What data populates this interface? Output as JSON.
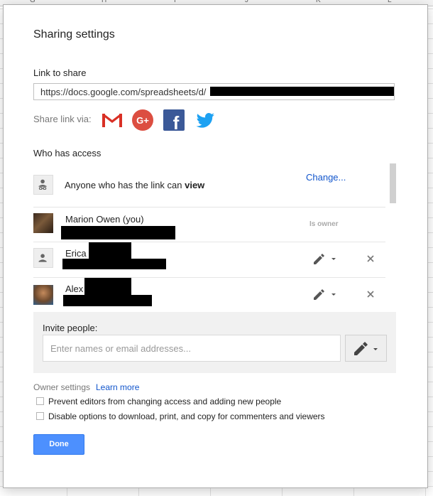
{
  "spreadsheet": {
    "columns": [
      "G",
      "H",
      "I",
      "J",
      "K",
      "L"
    ]
  },
  "dialog": {
    "title": "Sharing settings",
    "link_section": {
      "label": "Link to share",
      "url": "https://docs.google.com/spreadsheets/d/"
    },
    "share_via": {
      "label": "Share link via:",
      "icons": [
        "gmail-icon",
        "google-plus-icon",
        "facebook-icon",
        "twitter-icon"
      ],
      "google_plus_text": "G+",
      "facebook_text": "f"
    },
    "access_section": {
      "label": "Who has access",
      "link_access": {
        "text": "Anyone who has the link can ",
        "permission": "view",
        "change_label": "Change..."
      },
      "people": [
        {
          "name": "Marion Owen (you)",
          "role": "Is owner"
        },
        {
          "name": "Erica"
        },
        {
          "name": "Alex"
        }
      ]
    },
    "invite": {
      "label": "Invite people:",
      "placeholder": "Enter names or email addresses..."
    },
    "owner_settings": {
      "label": "Owner settings",
      "learn_more": "Learn more",
      "options": [
        "Prevent editors from changing access and adding new people",
        "Disable options to download, print, and copy for commenters and viewers"
      ]
    },
    "done_label": "Done",
    "colors": {
      "link": "#1155cc",
      "done_button": "#4d90fe",
      "gmail_red": "#d93025",
      "google_plus": "#dc4e41",
      "facebook": "#3b5998",
      "twitter": "#1da1f2"
    }
  }
}
